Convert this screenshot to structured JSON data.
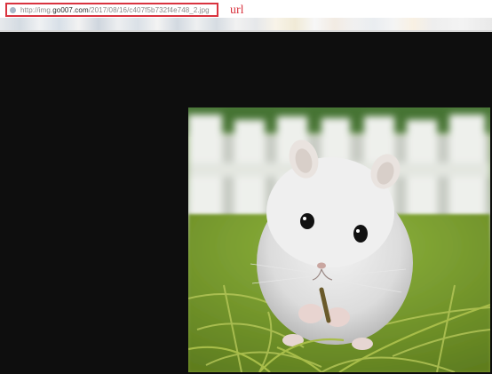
{
  "address_bar": {
    "url_prefix": "http://img.",
    "url_host": "go007.com",
    "url_path": "/2017/08/16/c407f5b732f4e748_2.jpg",
    "annotation": "url",
    "annotation_color": "#d9333f"
  },
  "image": {
    "subject": "white hamster on grass in front of a white picket fence"
  }
}
